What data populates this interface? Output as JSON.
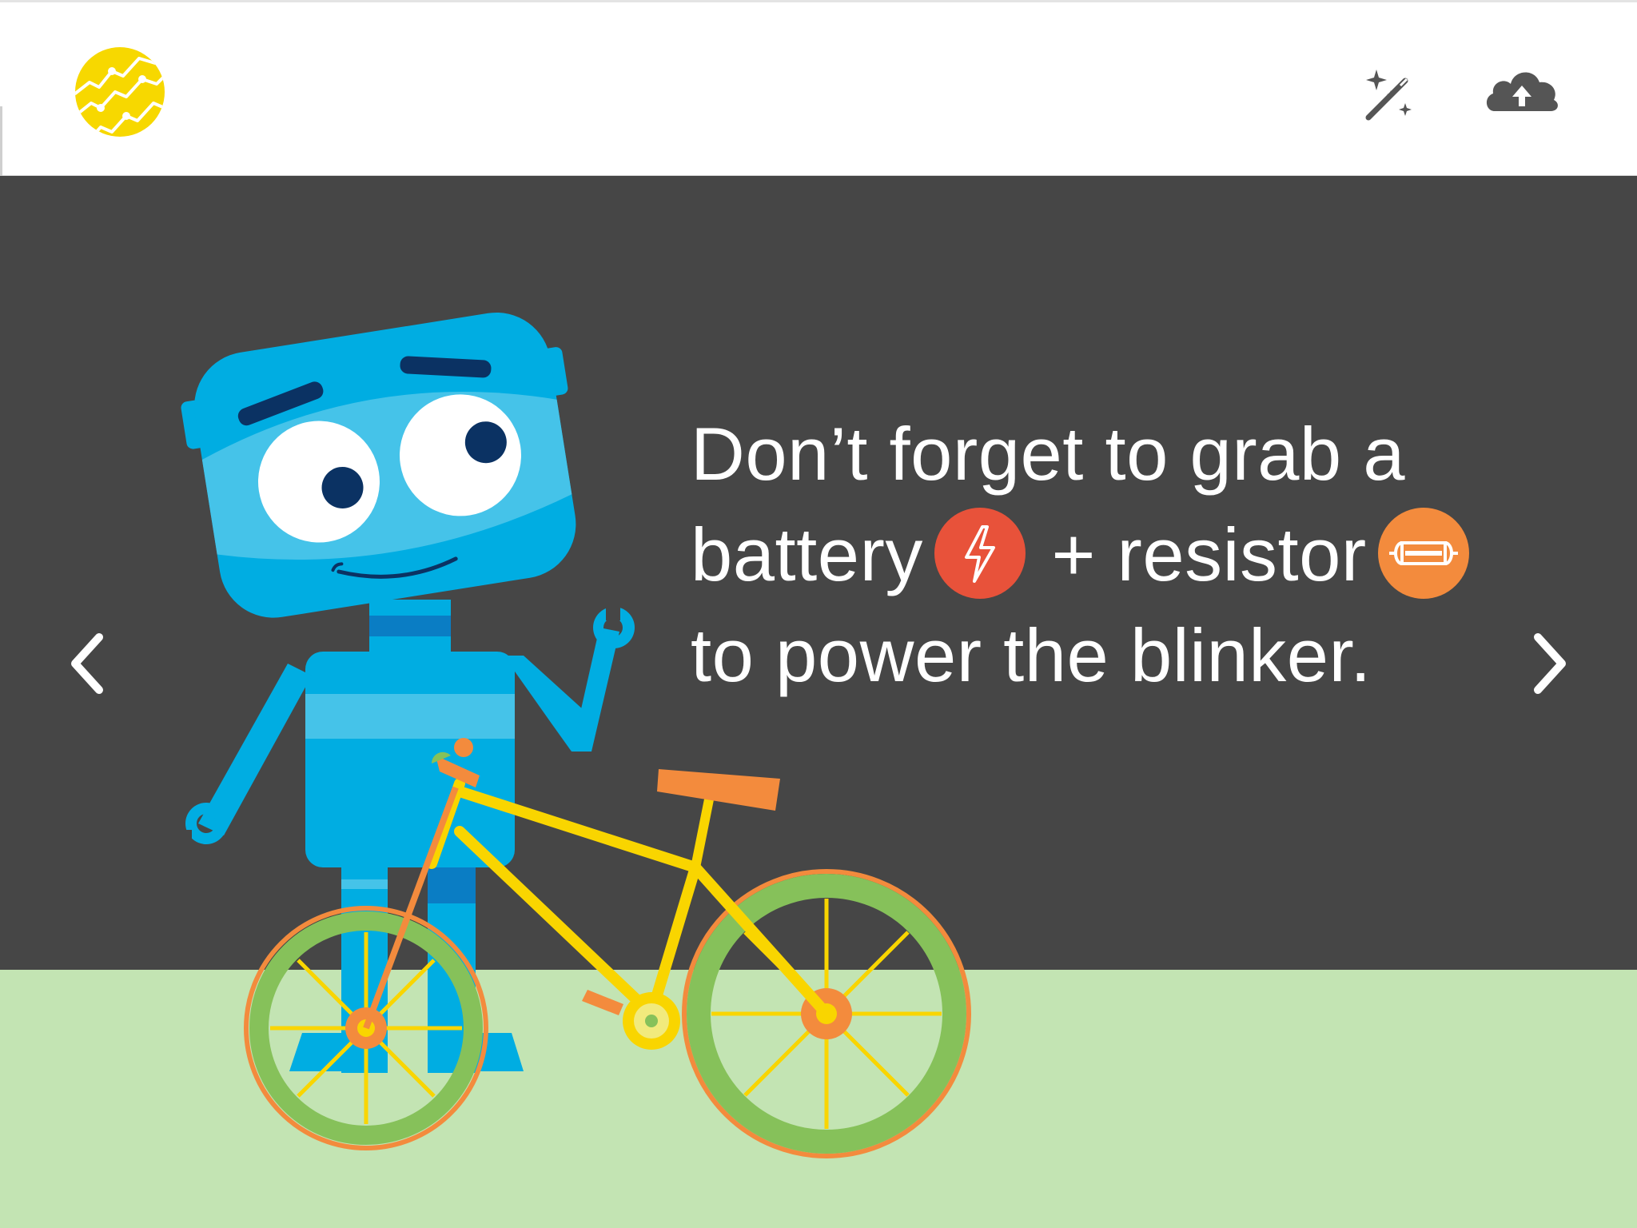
{
  "header": {
    "logo_icon": "lightning-circuit-logo-icon",
    "tools": [
      {
        "name": "magic-wand-icon"
      },
      {
        "name": "cloud-upload-icon"
      }
    ]
  },
  "slide": {
    "line1": "Don’t forget to grab a",
    "line2_a": "battery",
    "line2_b": "+ resistor",
    "line3": "to power the blinker.",
    "battery_icon": "battery-lightning-icon",
    "resistor_icon": "resistor-icon"
  },
  "nav": {
    "prev_icon": "chevron-left-icon",
    "next_icon": "chevron-right-icon"
  },
  "colors": {
    "stage": "#464646",
    "ground": "#c3e4b3",
    "robot": "#00ade2",
    "robot_light": "#45c3e9",
    "battery": "#e8523a",
    "resistor": "#f38b3d",
    "bike_frame": "#f9d500",
    "tire": "#86c15a",
    "logo": "#f7d800"
  }
}
